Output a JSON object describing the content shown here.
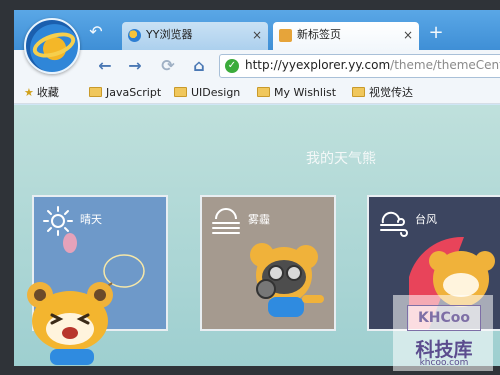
{
  "browser": {
    "tabs": [
      {
        "label": "YY浏览器",
        "close": "×"
      },
      {
        "label": "新标签页",
        "close": "×"
      }
    ],
    "new_tab": "+",
    "url": {
      "host": "http://yyexplorer.yy.com",
      "path": "/theme/themeCenter.h"
    }
  },
  "bookmarks": [
    {
      "label": "收藏",
      "icon": "star-icon"
    },
    {
      "label": "JavaScript",
      "icon": "folder-icon"
    },
    {
      "label": "UIDesign",
      "icon": "folder-icon"
    },
    {
      "label": "My Wishlist",
      "icon": "folder-icon"
    },
    {
      "label": "视觉传达",
      "icon": "folder-icon"
    }
  ],
  "page": {
    "heading": "我的天气熊",
    "cards": [
      {
        "label": "晴天",
        "icon": "sun-icon",
        "color": "#6e99c9"
      },
      {
        "label": "雾霾",
        "icon": "haze-icon",
        "color": "#a59a8f"
      },
      {
        "label": "台风",
        "icon": "typhoon-icon",
        "color": "#3c4560"
      }
    ]
  },
  "watermark": {
    "box": "KHCoo",
    "title": "科技库",
    "url": "khcoo.com"
  }
}
